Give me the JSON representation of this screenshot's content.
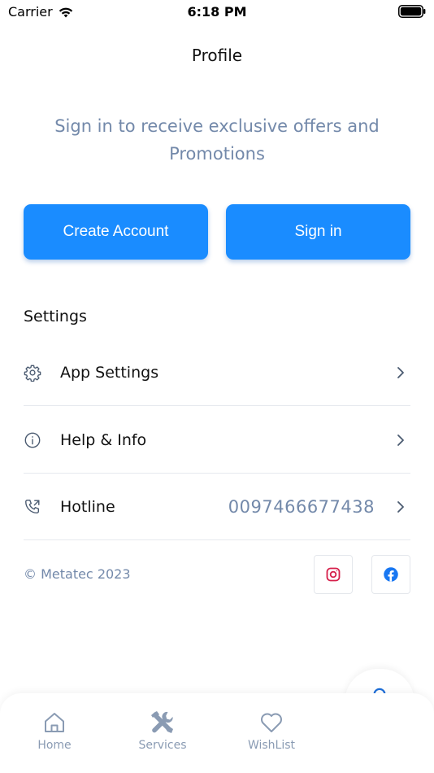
{
  "status_bar": {
    "carrier": "Carrier",
    "time": "6:18 PM",
    "icons": [
      "wifi-icon",
      "battery-icon"
    ]
  },
  "header": {
    "title": "Profile"
  },
  "promo": {
    "text": "Sign in to receive exclusive offers and Promotions"
  },
  "actions": {
    "create_account": "Create Account",
    "sign_in": "Sign in"
  },
  "settings": {
    "heading": "Settings",
    "items": [
      {
        "label": "App Settings",
        "icon": "gear-icon",
        "value": ""
      },
      {
        "label": "Help & Info",
        "icon": "info-icon",
        "value": ""
      },
      {
        "label": "Hotline",
        "icon": "phone-icon",
        "value": "0097466677438"
      }
    ]
  },
  "footer": {
    "copyright": "© Metatec 2023",
    "social": [
      "instagram-icon",
      "facebook-icon"
    ]
  },
  "bottom_nav": {
    "items": [
      {
        "label": "Home",
        "icon": "home-icon"
      },
      {
        "label": "Services",
        "icon": "tools-icon"
      },
      {
        "label": "WishList",
        "icon": "heart-icon"
      },
      {
        "label": "",
        "icon": "user-icon",
        "active": true
      }
    ]
  },
  "colors": {
    "primary": "#1a8cff",
    "muted_text": "#7389aa",
    "nav_inactive": "#8a9bb3",
    "active_icon": "#1e6fd9",
    "instagram": "#d6204b",
    "facebook": "#1877f2"
  }
}
